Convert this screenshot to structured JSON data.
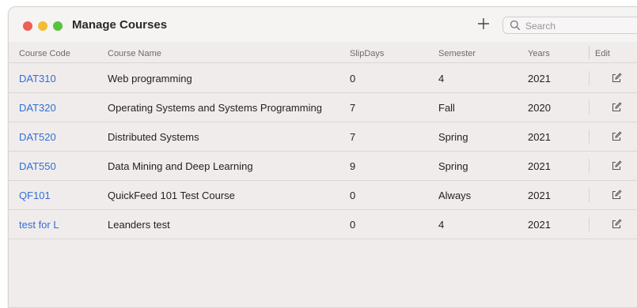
{
  "window": {
    "title": "Manage Courses",
    "search": {
      "placeholder": "Search",
      "value": ""
    }
  },
  "icons": {
    "add": "plus-icon",
    "search": "magnifying-glass-icon",
    "edit": "edit-square-icon"
  },
  "table": {
    "columns": [
      "Course Code",
      "Course Name",
      "SlipDays",
      "Semester",
      "Years",
      "Edit"
    ],
    "rows": [
      {
        "code": "DAT310",
        "name": "Web programming",
        "slipdays": "0",
        "semester": "4",
        "year": "2021"
      },
      {
        "code": "DAT320",
        "name": "Operating Systems and Systems Programming",
        "slipdays": "7",
        "semester": "Fall",
        "year": "2020"
      },
      {
        "code": "DAT520",
        "name": "Distributed Systems",
        "slipdays": "7",
        "semester": "Spring",
        "year": "2021"
      },
      {
        "code": "DAT550",
        "name": "Data Mining and Deep Learning",
        "slipdays": "9",
        "semester": "Spring",
        "year": "2021"
      },
      {
        "code": "QF101",
        "name": "QuickFeed 101 Test Course",
        "slipdays": "0",
        "semester": "Always",
        "year": "2021"
      },
      {
        "code": "test for L",
        "name": "Leanders test",
        "slipdays": "0",
        "semester": "4",
        "year": "2021"
      }
    ]
  },
  "colors": {
    "link": "#2f6fd6",
    "close": "#ee5d56",
    "minimize": "#f2bd30",
    "zoom": "#59c23f"
  }
}
